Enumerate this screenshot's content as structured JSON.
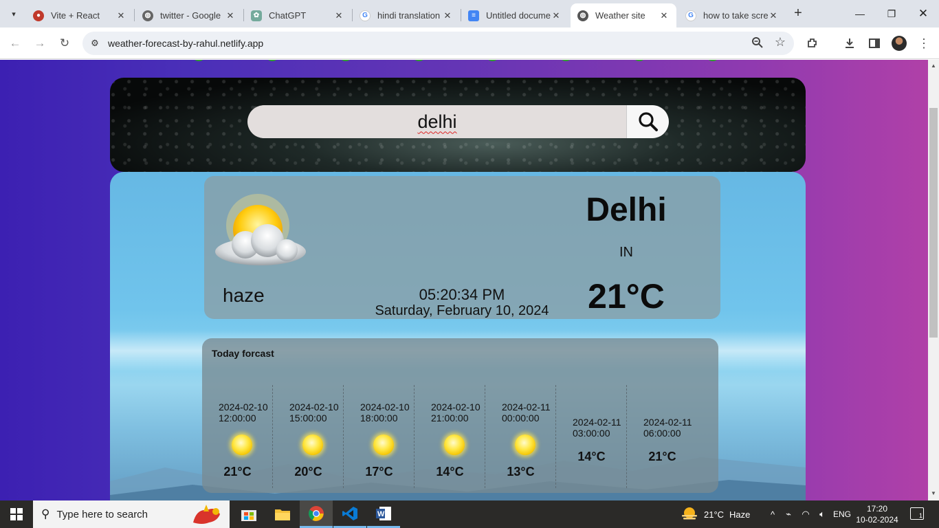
{
  "browser": {
    "tabs": [
      {
        "title": "Vite + React",
        "icon": "pizza-favicon",
        "active": false
      },
      {
        "title": "twitter - Google",
        "icon": "globe-favicon",
        "active": false
      },
      {
        "title": "ChatGPT",
        "icon": "chatgpt-favicon",
        "active": false
      },
      {
        "title": "hindi translation",
        "icon": "google-favicon",
        "active": false
      },
      {
        "title": "Untitled docume",
        "icon": "docs-favicon",
        "active": false
      },
      {
        "title": "Weather site",
        "icon": "globe-favicon",
        "active": true
      },
      {
        "title": "how to take scre",
        "icon": "google-favicon",
        "active": false
      }
    ],
    "url": "weather-forecast-by-rahul.netlify.app"
  },
  "site": {
    "search": {
      "value": "delhi"
    },
    "current": {
      "city": "Delhi",
      "country": "IN",
      "temperature": "21°C",
      "condition": "haze",
      "time": "05:20:34 PM",
      "date": "Saturday, February 10, 2024"
    },
    "forecast": {
      "title": "Today forcast",
      "items": [
        {
          "date": "2024-02-10",
          "time": "12:00:00",
          "temp": "21°C",
          "icon": "sun-icon"
        },
        {
          "date": "2024-02-10",
          "time": "15:00:00",
          "temp": "20°C",
          "icon": "sun-icon"
        },
        {
          "date": "2024-02-10",
          "time": "18:00:00",
          "temp": "17°C",
          "icon": "sun-icon"
        },
        {
          "date": "2024-02-10",
          "time": "21:00:00",
          "temp": "14°C",
          "icon": "sun-icon"
        },
        {
          "date": "2024-02-11",
          "time": "00:00:00",
          "temp": "13°C",
          "icon": "sun-icon"
        },
        {
          "date": "2024-02-11",
          "time": "03:00:00",
          "temp": "14°C",
          "icon": ""
        },
        {
          "date": "2024-02-11",
          "time": "06:00:00",
          "temp": "21°C",
          "icon": ""
        }
      ]
    }
  },
  "taskbar": {
    "search_placeholder": "Type here to search",
    "weather": {
      "temp": "21°C",
      "condition": "Haze"
    },
    "language": "ENG",
    "time": "17:20",
    "date": "10-02-2024",
    "notification_count": "1"
  },
  "colors": {
    "page_gradient_start": "#3c20b2",
    "page_gradient_end": "#b040a8",
    "accent_tab": "#ffffff",
    "taskbar": "#2b2a28"
  }
}
